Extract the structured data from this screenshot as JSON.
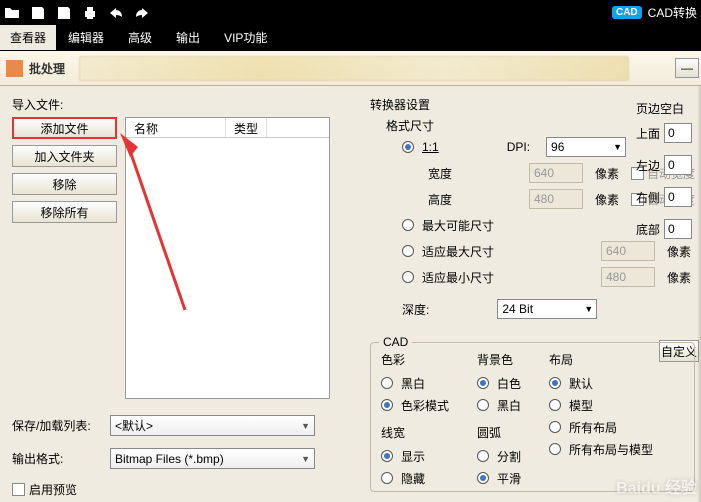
{
  "toolbar_right": {
    "badge": "CAD",
    "label": "CAD转换"
  },
  "menubar": {
    "active": "查看器",
    "items": [
      "编辑器",
      "高级",
      "输出",
      "VIP功能"
    ]
  },
  "sub_toolbar": {
    "label": "批处理"
  },
  "left": {
    "import_label": "导入文件:",
    "buttons": {
      "add_file": "添加文件",
      "add_folder": "加入文件夹",
      "remove": "移除",
      "remove_all": "移除所有"
    },
    "cols": {
      "name": "名称",
      "type": "类型"
    },
    "list_label": "保存/加载列表:",
    "list_value": "<默认>",
    "output_label": "输出格式:",
    "output_value": "Bitmap Files (*.bmp)",
    "preview": "启用预览"
  },
  "right": {
    "title": "转换器设置",
    "fmt": {
      "title": "格式尺寸",
      "r11": "1:1",
      "dpi_label": "DPI:",
      "dpi_value": "96",
      "width_label": "宽度",
      "width_value": "640",
      "px": "像素",
      "auto_w": "自动宽度",
      "height_label": "高度",
      "height_value": "480",
      "auto_h": "自动高度",
      "max": "最大可能尺寸",
      "fit_max": "适应最大尺寸",
      "fit_max_v": "640",
      "fit_min": "适应最小尺寸",
      "fit_min_v": "480",
      "depth_label": "深度:",
      "depth_value": "24 Bit",
      "custom": "自定义"
    },
    "margins": {
      "title": "页边空白",
      "top": "上面",
      "left": "左边",
      "right": "右侧",
      "bottom": "底部",
      "v": "0"
    },
    "cad": {
      "title": "CAD",
      "color": {
        "title": "色彩",
        "bw": "黑白",
        "color": "色彩模式"
      },
      "bg": {
        "title": "背景色",
        "white": "白色",
        "black": "黑白"
      },
      "layout": {
        "title": "布局",
        "default": "默认",
        "model": "模型",
        "all": "所有布局",
        "all_model": "所有布局与模型"
      },
      "line": {
        "title": "线宽",
        "show": "显示",
        "hide": "隐藏"
      },
      "arc": {
        "title": "圆弧",
        "split": "分割",
        "smooth": "平滑"
      }
    }
  }
}
